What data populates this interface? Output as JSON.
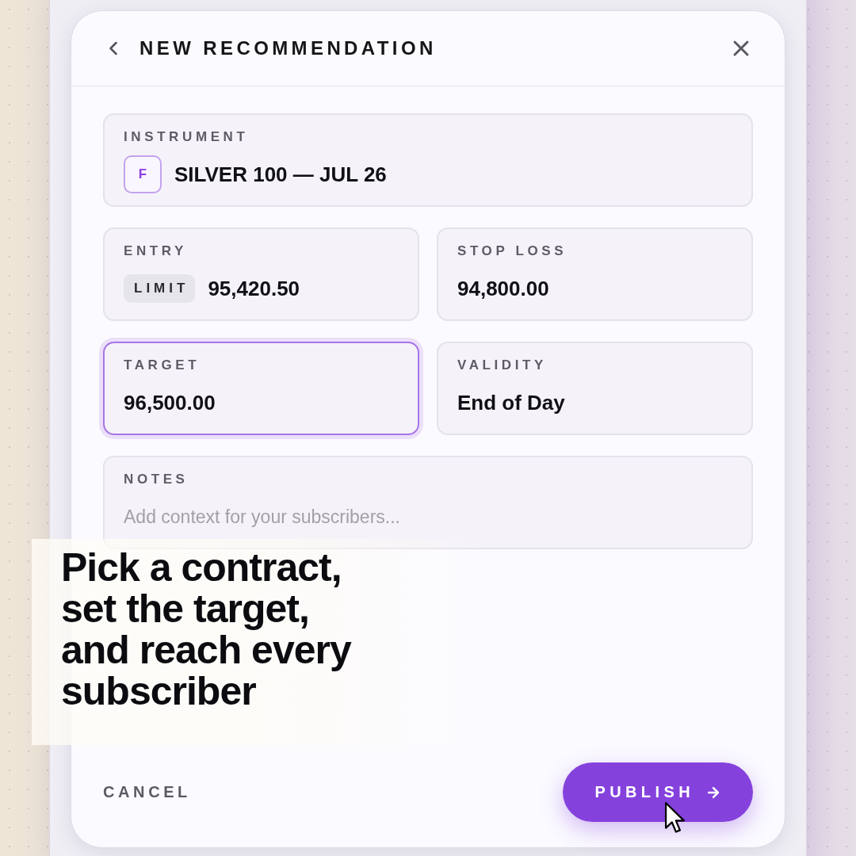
{
  "dialog": {
    "title": "NEW RECOMMENDATION"
  },
  "fields": [
    {
      "kind": "instrument",
      "label": "INSTRUMENT",
      "badge": "F",
      "value": "SILVER 100 — JUL 26",
      "focused": false
    },
    {
      "kind": "price",
      "label": "ENTRY",
      "tag": "LIMIT",
      "value": "95,420.50",
      "focused": false
    },
    {
      "kind": "price",
      "label": "STOP LOSS",
      "value": "94,800.00",
      "focused": false
    },
    {
      "kind": "price",
      "label": "TARGET",
      "value": "96,500.00",
      "focused": true
    },
    {
      "kind": "choice",
      "label": "VALIDITY",
      "value": "End of Day",
      "focused": false
    },
    {
      "kind": "notes",
      "label": "NOTES",
      "placeholder": "Add context for your subscribers...",
      "focused": false
    }
  ],
  "footer": {
    "cancel": "CANCEL",
    "publish": "PUBLISH"
  },
  "caption": "Pick a contract,\nset the target,\nand reach every\nsubscriber"
}
